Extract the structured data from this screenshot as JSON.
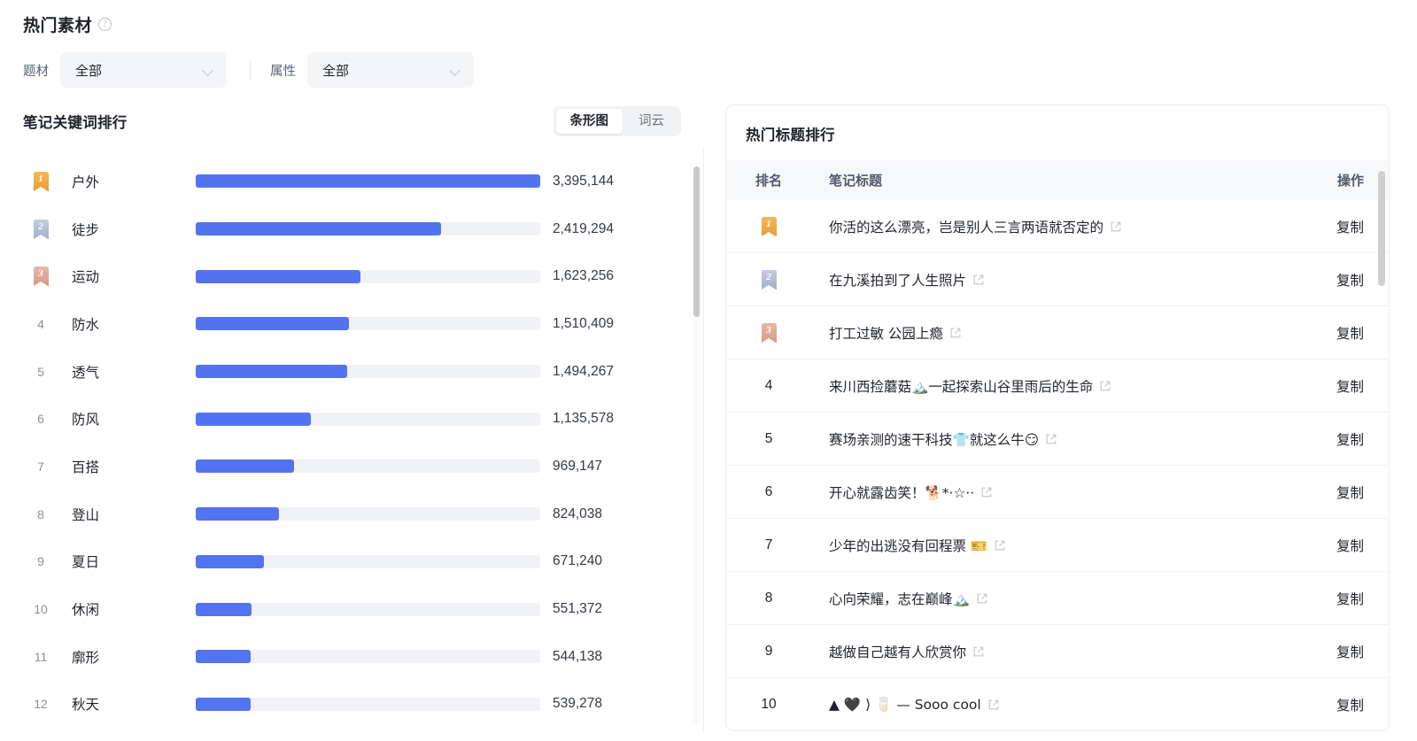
{
  "header": {
    "title": "热门素材",
    "help_icon": "question-circle-icon"
  },
  "filters": [
    {
      "label": "题材",
      "value": "全部",
      "icon": "chevron-down-icon"
    },
    {
      "label": "属性",
      "value": "全部",
      "icon": "chevron-down-icon"
    }
  ],
  "left_panel": {
    "title": "笔记关键词排行",
    "tabs": [
      {
        "label": "条形图",
        "active": true
      },
      {
        "label": "词云",
        "active": false
      }
    ]
  },
  "right_panel": {
    "title": "热门标题排行",
    "columns": [
      "排名",
      "笔记标题",
      "操作"
    ],
    "action_label": "复制",
    "rows": [
      {
        "rank": "1",
        "title": "你活的这么漂亮，岂是别人三言两语就否定的",
        "action": "复制"
      },
      {
        "rank": "2",
        "title": "在九溪拍到了人生照片",
        "action": "复制"
      },
      {
        "rank": "3",
        "title": "打工过敏 公园上瘾",
        "action": "复制"
      },
      {
        "rank": "4",
        "title": "来川西捡蘑菇🏔️一起探索山谷里雨后的生命",
        "action": "复制"
      },
      {
        "rank": "5",
        "title": "赛场亲测的速干科技👕就这么牛😏",
        "action": "复制"
      },
      {
        "rank": "6",
        "title": "开心就露齿笑！🐕*‧☆‧‧",
        "action": "复制"
      },
      {
        "rank": "7",
        "title": "少年的出逃没有回程票 🎫",
        "action": "复制"
      },
      {
        "rank": "8",
        "title": "心向荣耀，志在巅峰🏔️",
        "action": "复制"
      },
      {
        "rank": "9",
        "title": "越做自己越有人欣赏你",
        "action": "复制"
      },
      {
        "rank": "10",
        "title": "▲ 🖤 ⟩ 🥛 — Sooo cool",
        "action": "复制"
      }
    ]
  },
  "chart_data": {
    "type": "bar",
    "title": "笔记关键词排行",
    "xlabel": "",
    "ylabel": "",
    "orientation": "horizontal",
    "max_value": 3395144,
    "categories": [
      "户外",
      "徒步",
      "运动",
      "防水",
      "透气",
      "防风",
      "百搭",
      "登山",
      "夏日",
      "休闲",
      "廓形",
      "秋天"
    ],
    "values": [
      3395144,
      2419294,
      1623256,
      1510409,
      1494267,
      1135578,
      969147,
      824038,
      671240,
      551372,
      544138,
      539278
    ],
    "value_labels": [
      "3,395,144",
      "2,419,294",
      "1,623,256",
      "1,510,409",
      "1,494,267",
      "1,135,578",
      "969,147",
      "824,038",
      "671,240",
      "551,372",
      "544,138",
      "539,278"
    ],
    "ranks": [
      "1",
      "2",
      "3",
      "4",
      "5",
      "6",
      "7",
      "8",
      "9",
      "10",
      "11",
      "12"
    ],
    "bar_color": "#5274f0",
    "track_color": "#f1f2f5",
    "grid": false,
    "legend": false
  }
}
